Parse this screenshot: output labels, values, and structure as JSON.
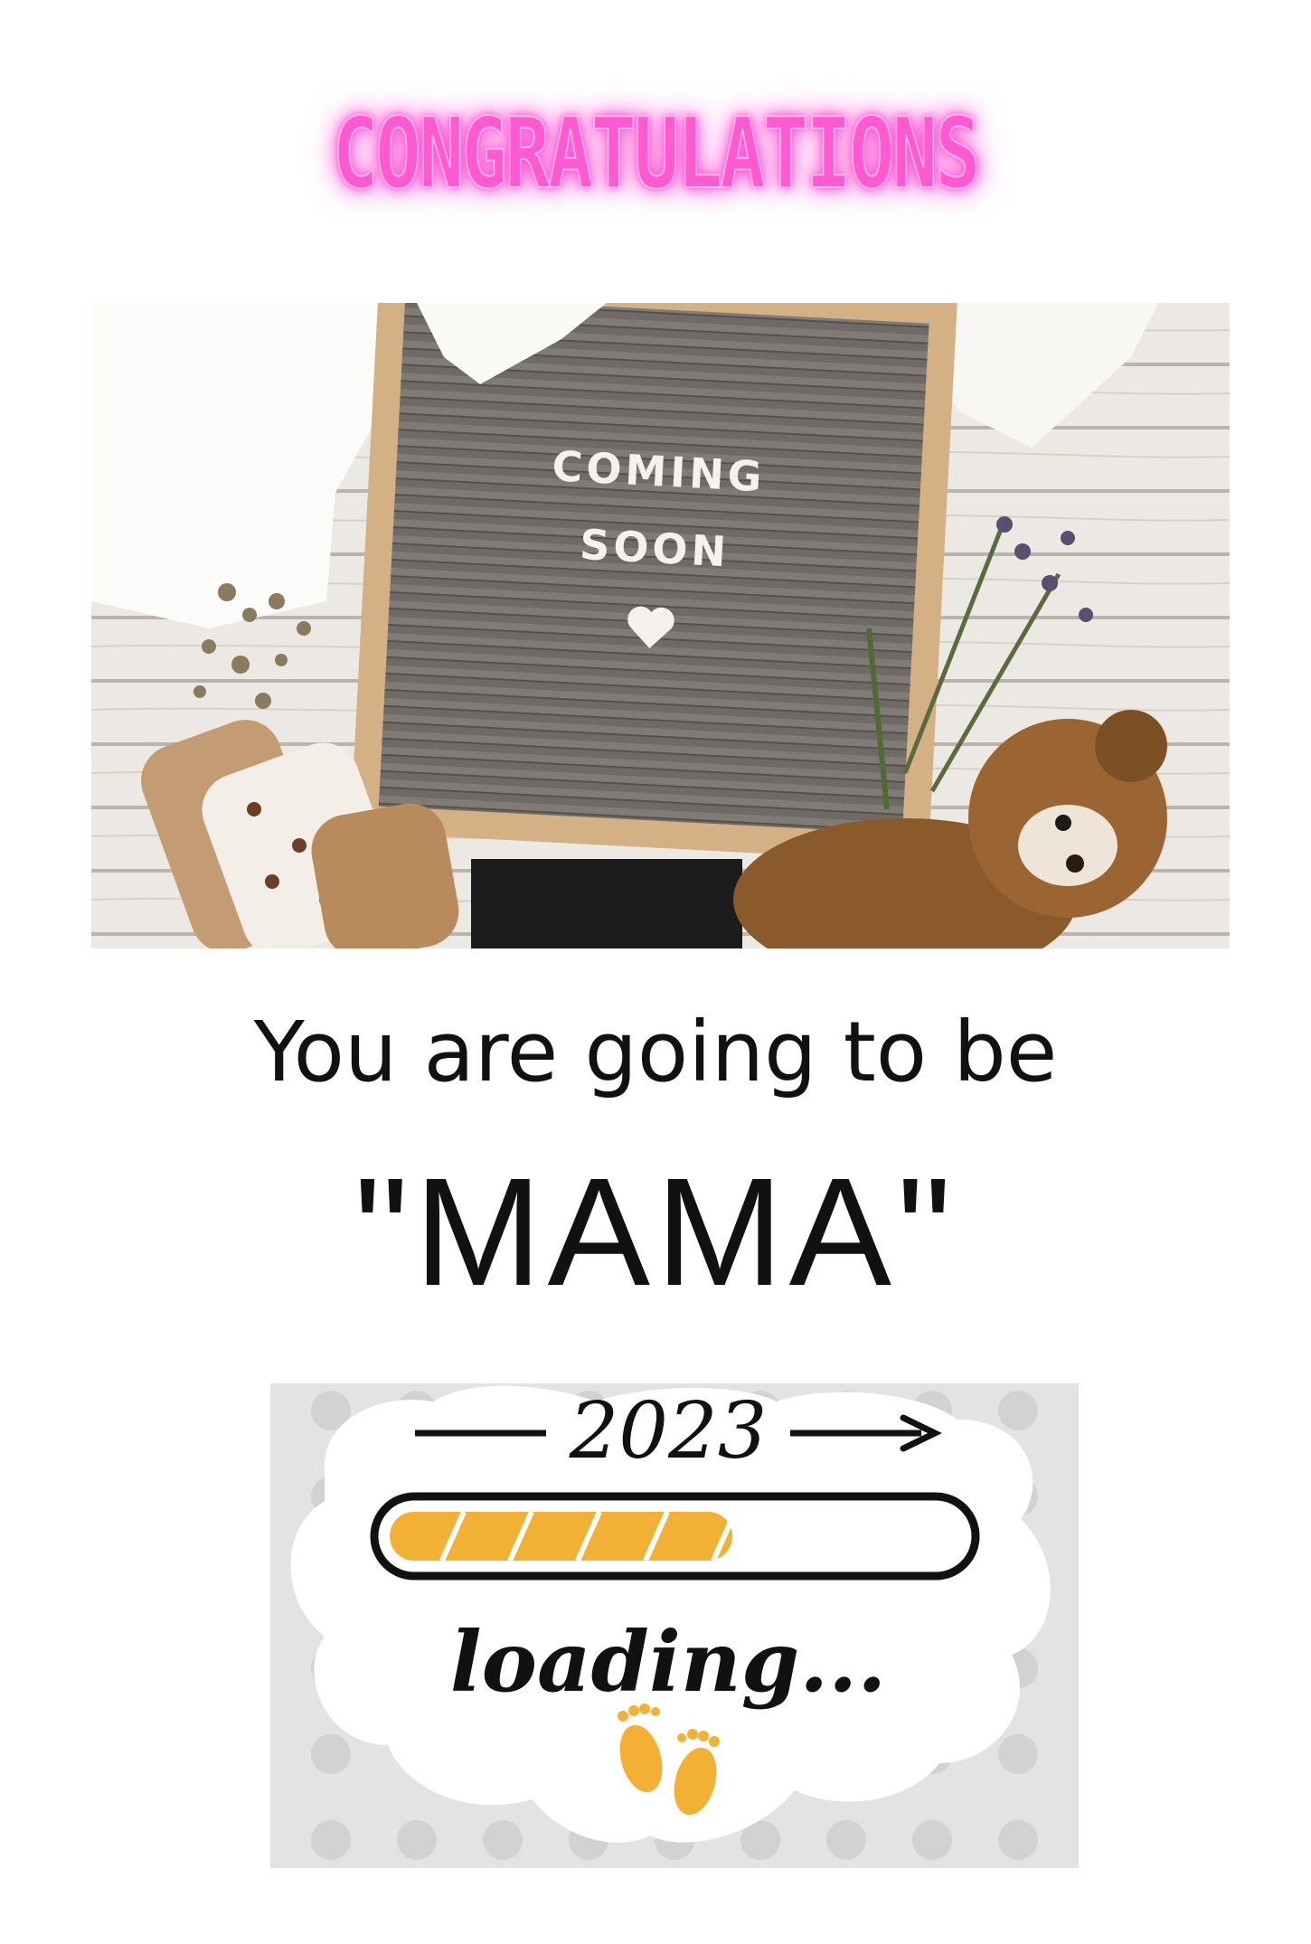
{
  "headline": {
    "text": "CONGRATULATIONS",
    "color": "#ff4fd0"
  },
  "photo": {
    "letter_board": {
      "line1": "COMING",
      "line2": "SOON",
      "symbol": "heart"
    }
  },
  "message": {
    "line1": "You are going to be",
    "line2": "\"MAMA\""
  },
  "sticker": {
    "year": "2023",
    "progress_fraction": 0.6,
    "progress_color": "#f2b134",
    "status": "loading...",
    "footprints_color": "#f2b134"
  }
}
